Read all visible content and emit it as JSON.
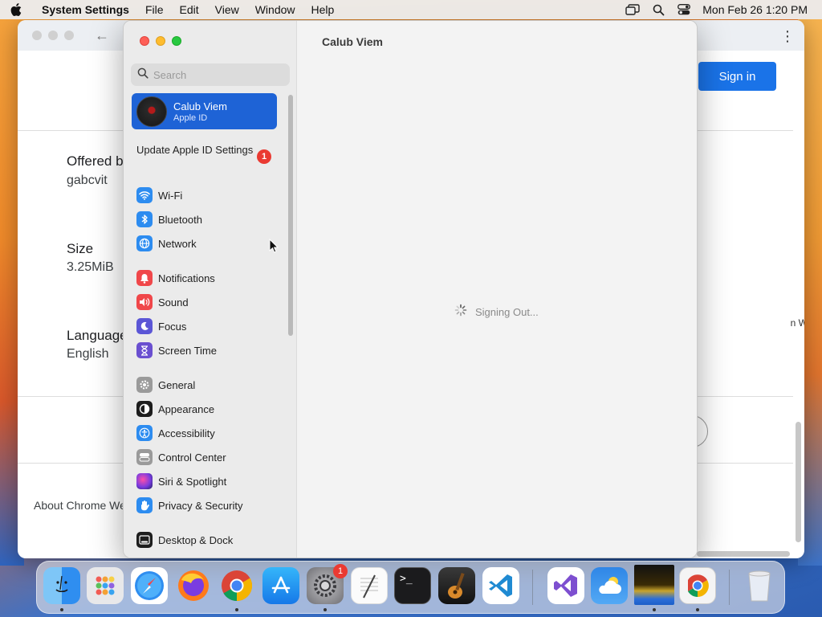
{
  "menubar": {
    "app_name": "System Settings",
    "menus": [
      "File",
      "Edit",
      "View",
      "Window",
      "Help"
    ],
    "datetime": "Mon Feb 26  1:20 PM"
  },
  "chrome": {
    "sign_in": "Sign in",
    "offered_label": "Offered b",
    "offered_value": "gabcvit",
    "size_label": "Size",
    "size_value": "3.25MiB",
    "language_label": "Language",
    "language_value": "English",
    "about": "About Chrome We",
    "edge_text": "n W"
  },
  "settings": {
    "search_placeholder": "Search",
    "account": {
      "name": "Calub Viem",
      "subtitle": "Apple ID"
    },
    "update_label": "Update Apple ID Settings",
    "update_badge": "1",
    "items": [
      {
        "label": "Wi-Fi",
        "icon": "wifi-icon",
        "color": "#2d8cf0"
      },
      {
        "label": "Bluetooth",
        "icon": "bluetooth-icon",
        "color": "#2d8cf0"
      },
      {
        "label": "Network",
        "icon": "globe-icon",
        "color": "#2d8cf0"
      },
      {
        "label": "Notifications",
        "icon": "bell-icon",
        "color": "#f0474a"
      },
      {
        "label": "Sound",
        "icon": "speaker-icon",
        "color": "#f0474a"
      },
      {
        "label": "Focus",
        "icon": "moon-icon",
        "color": "#5b56d6"
      },
      {
        "label": "Screen Time",
        "icon": "hourglass-icon",
        "color": "#6a4fd0"
      },
      {
        "label": "General",
        "icon": "gear-icon",
        "color": "#9a9a9a"
      },
      {
        "label": "Appearance",
        "icon": "appearance-icon",
        "color": "#1d1d1d"
      },
      {
        "label": "Accessibility",
        "icon": "accessibility-icon",
        "color": "#2d8cf0"
      },
      {
        "label": "Control Center",
        "icon": "control-center-icon",
        "color": "#9a9a9a"
      },
      {
        "label": "Siri & Spotlight",
        "icon": "siri-icon",
        "color": "#8a3fd8"
      },
      {
        "label": "Privacy & Security",
        "icon": "hand-icon",
        "color": "#2d8cf0"
      },
      {
        "label": "Desktop & Dock",
        "icon": "dock-icon",
        "color": "#1d1d1d"
      }
    ],
    "content_title": "Calub Viem",
    "status_text": "Signing Out..."
  },
  "dock": {
    "apps": [
      "finder-icon",
      "launchpad-icon",
      "safari-icon",
      "firefox-icon",
      "chrome-icon",
      "app-store-icon",
      "system-settings-icon",
      "textedit-icon",
      "terminal-icon",
      "garageband-icon",
      "vscode-icon",
      "visual-studio-icon",
      "weather-icon",
      "image-preview-icon",
      "chrome-web-app-icon",
      "trash-icon"
    ],
    "settings_badge": "1"
  }
}
